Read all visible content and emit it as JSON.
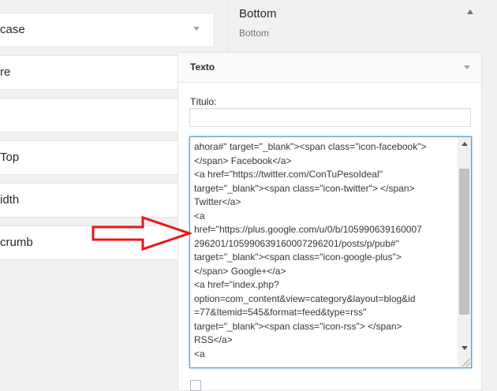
{
  "left_items": [
    {
      "label": "case"
    },
    {
      "label": "re"
    },
    {
      "label": ""
    },
    {
      "label": "Top"
    },
    {
      "label": "idth"
    },
    {
      "label": "crumb"
    }
  ],
  "sidebar": {
    "title": "Bottom",
    "description": "Bottom"
  },
  "widget": {
    "title": "Texto",
    "titulo_label": "Título:",
    "titulo_value": "",
    "content_lines": [
      "ahora#\" target=\"_blank\"><span class=\"icon-facebook\">",
      "</span> Facebook</a>",
      "<a href=\"https://twitter.com/ConTuPesoIdeal\"",
      "target=\"_blank\"><span class=\"icon-twitter\"> </span>",
      "Twitter</a>",
      "<a",
      "href=\"https://plus.google.com/u/0/b/105990639160007",
      "296201/105990639160007296201/posts/p/pub#\"",
      "target=\"_blank\"><span class=\"icon-google-plus\">",
      "</span> Google+</a>",
      "<a href=\"index.php?",
      "option=com_content&view=category&layout=blog&id",
      "=77&Itemid=545&format=feed&type=rss\"",
      "target=\"_blank\"><span class=\"icon-rss\"> </span>",
      "RSS</a>",
      "<a"
    ]
  },
  "colors": {
    "arrow": "#e8161b",
    "focus_border": "#5b9dd9"
  }
}
